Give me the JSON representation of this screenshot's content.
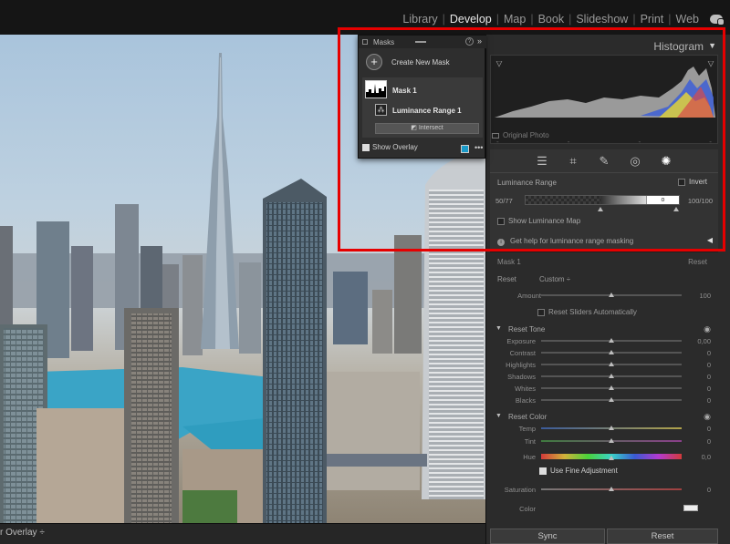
{
  "modules": [
    {
      "label": "Library",
      "active": false
    },
    {
      "label": "Develop",
      "active": true
    },
    {
      "label": "Map",
      "active": false
    },
    {
      "label": "Book",
      "active": false
    },
    {
      "label": "Slideshow",
      "active": false
    },
    {
      "label": "Print",
      "active": false
    },
    {
      "label": "Web",
      "active": false
    }
  ],
  "bottom_bar": {
    "overlay_label": "r Overlay ÷"
  },
  "histogram": {
    "title": "Histogram",
    "original_photo": "Original Photo",
    "tick_marks": [
      "-",
      "-",
      "-",
      "-"
    ]
  },
  "masks_panel": {
    "title": "Masks",
    "create_label": "Create New Mask",
    "mask_name": "Mask 1",
    "component_name": "Luminance Range 1",
    "intersect_label": "Intersect",
    "show_overlay_label": "Show Overlay",
    "show_overlay_checked": true,
    "overlay_color": "#1a9ac8",
    "more_label": "•••"
  },
  "luminance": {
    "title": "Luminance Range",
    "invert_label": "Invert",
    "left_value": "50/77",
    "right_value": "100/100",
    "show_map_label": "Show Luminance Map",
    "help_label": "Get help for luminance range masking"
  },
  "mask_section": {
    "title": "Mask 1",
    "reset_right": "Reset",
    "reset_left": "Reset",
    "preset": "Custom ÷",
    "amount_label": "Amount",
    "amount_value": "100",
    "amount_level": 0.5,
    "auto_label": "Reset Sliders Automatically"
  },
  "tone": {
    "title": "Reset Tone",
    "sliders": [
      {
        "label": "Exposure",
        "value": "0,00",
        "level": 0.5
      },
      {
        "label": "Contrast",
        "value": "0",
        "level": 0.5
      },
      {
        "label": "Highlights",
        "value": "0",
        "level": 0.5
      },
      {
        "label": "Shadows",
        "value": "0",
        "level": 0.5
      },
      {
        "label": "Whites",
        "value": "0",
        "level": 0.5
      },
      {
        "label": "Blacks",
        "value": "0",
        "level": 0.5
      }
    ]
  },
  "color": {
    "title": "Reset Color",
    "temp_label": "Temp",
    "temp_value": "0",
    "tint_label": "Tint",
    "tint_value": "0",
    "hue_label": "Hue",
    "hue_value": "0,0",
    "fine_label": "Use Fine Adjustment",
    "fine_checked": true,
    "saturation_label": "Saturation",
    "saturation_value": "0",
    "color_label": "Color"
  },
  "buttons": {
    "sync": "Sync",
    "reset": "Reset"
  },
  "accent": "#e60000"
}
